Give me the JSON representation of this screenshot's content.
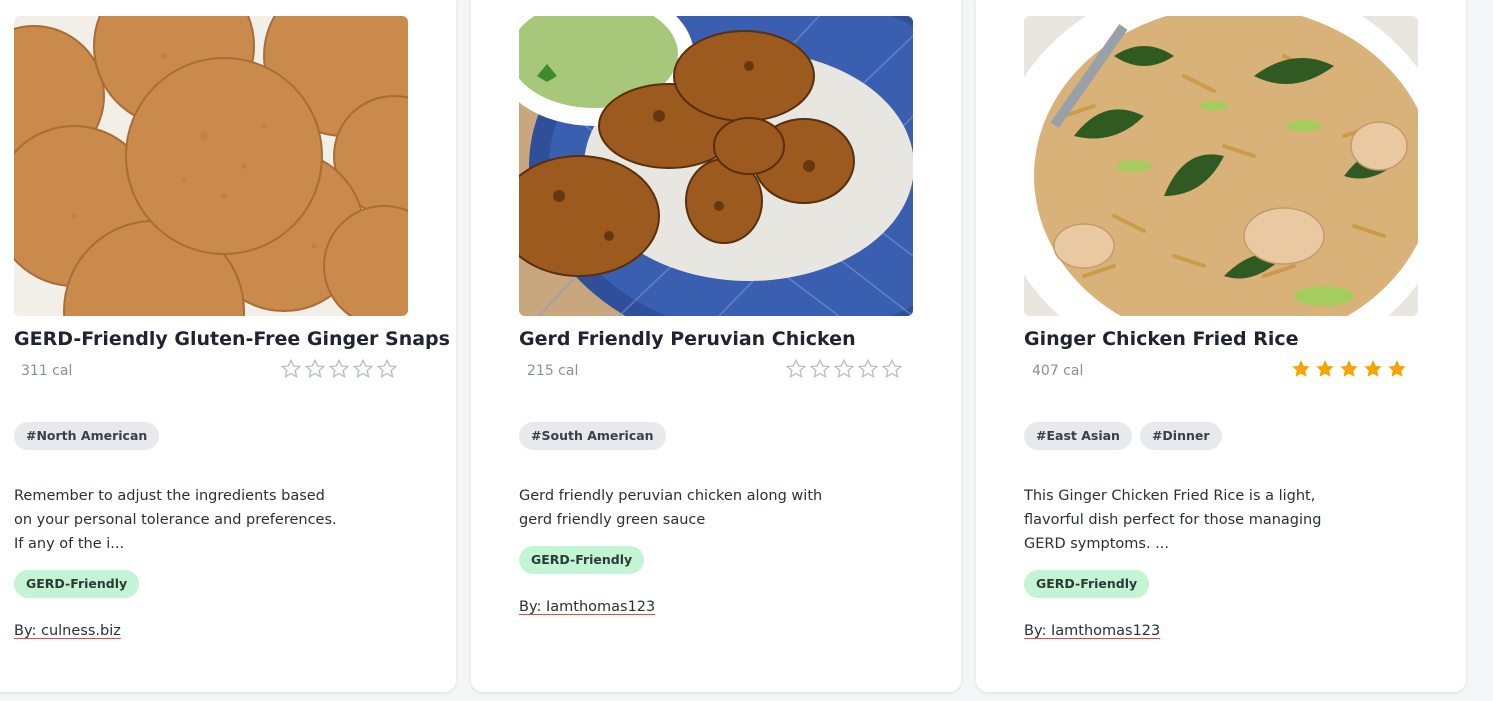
{
  "colors": {
    "star_filled": "#f5a400",
    "star_empty": "#b8bcc4",
    "badge_bg": "#c3f5d5",
    "tag_bg": "#e8e9ec"
  },
  "recipes": [
    {
      "image_alt": "ginger snap cookies",
      "title": "GERD-Friendly Gluten-Free Ginger Snaps",
      "calories": "311 cal",
      "rating": 0,
      "tags": [
        "#North American"
      ],
      "description": "Remember to adjust the ingredients based on your personal tolerance and preferences. If any of the i...",
      "badge": "GERD-Friendly",
      "author": "By: culness.biz"
    },
    {
      "image_alt": "grilled peruvian chicken with green sauce",
      "title": "Gerd Friendly Peruvian Chicken",
      "calories": "215 cal",
      "rating": 0,
      "tags": [
        "#South American"
      ],
      "description": "Gerd friendly peruvian chicken along with gerd friendly green sauce",
      "badge": "GERD-Friendly",
      "author": "By: Iamthomas123"
    },
    {
      "image_alt": "ginger chicken fried rice",
      "title": "Ginger Chicken Fried Rice",
      "calories": "407 cal",
      "rating": 5,
      "tags": [
        "#East Asian",
        "#Dinner"
      ],
      "description": "This Ginger Chicken Fried Rice is a light, flavorful dish perfect for those managing GERD symptoms. ...",
      "badge": "GERD-Friendly",
      "author": "By: Iamthomas123"
    }
  ]
}
